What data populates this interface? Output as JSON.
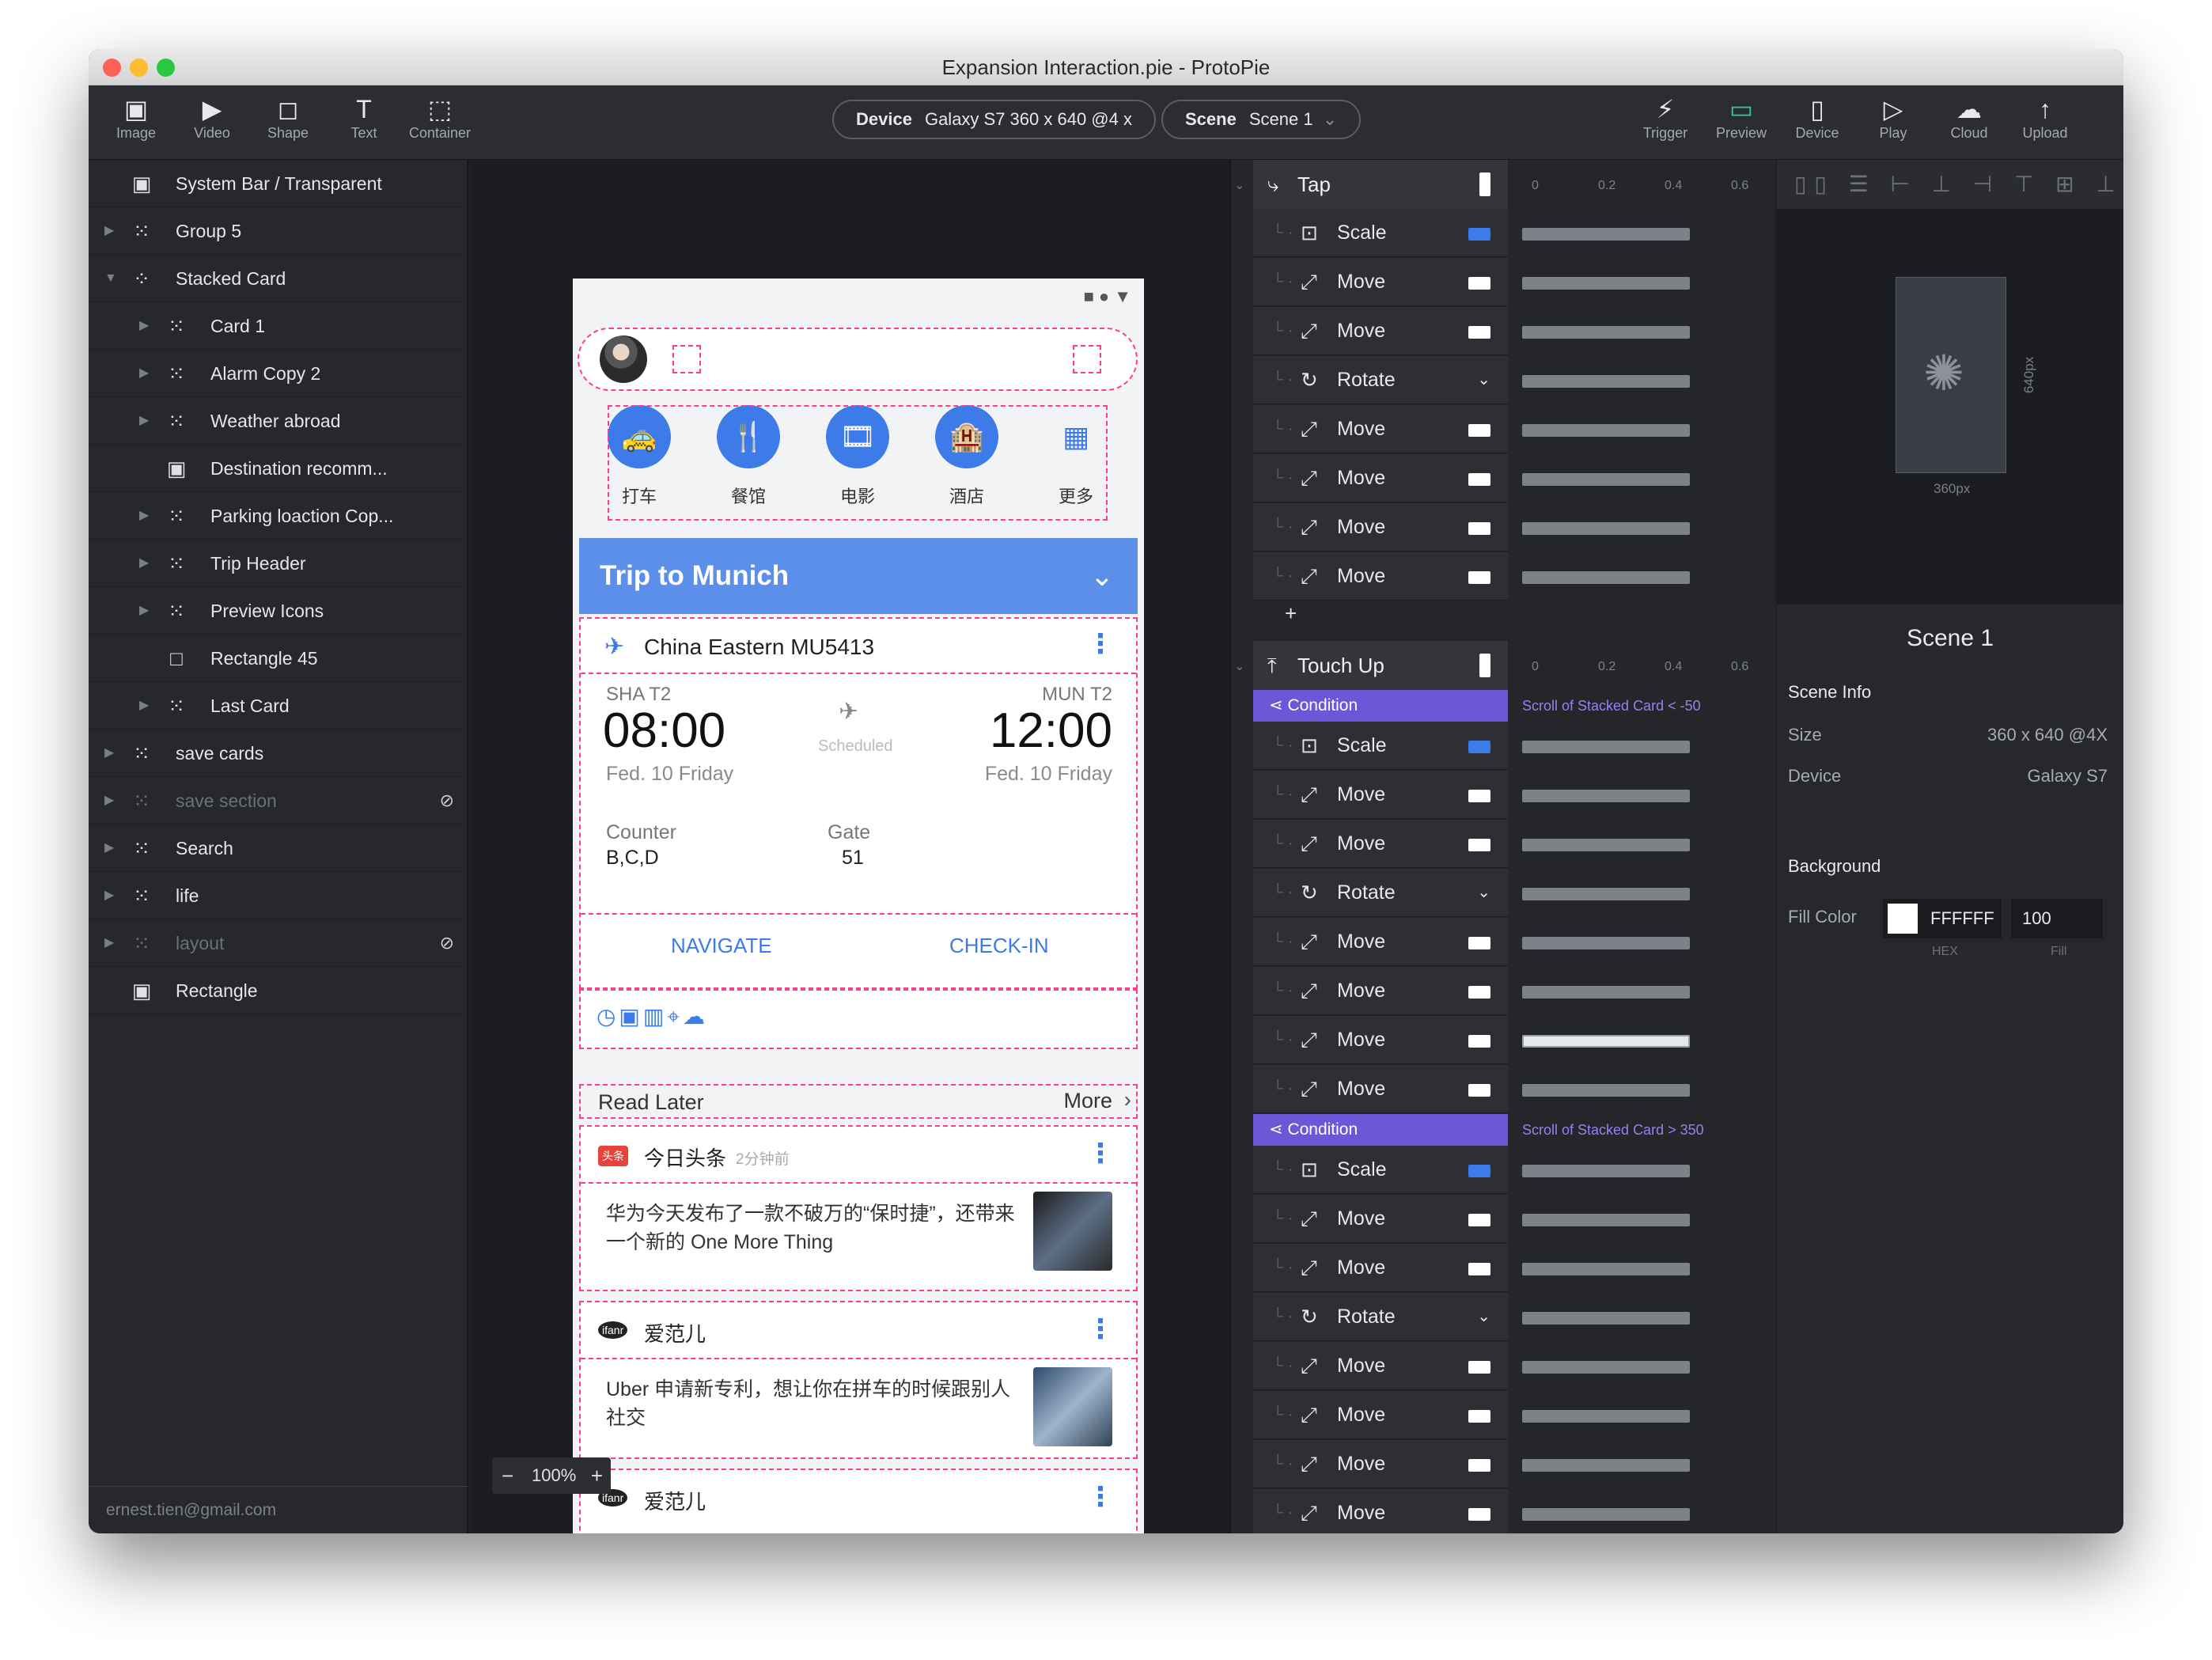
{
  "window": {
    "title": "Expansion Interaction.pie - ProtoPie"
  },
  "toolbar": {
    "left": [
      {
        "icon": "image-icon",
        "glyph": "▣",
        "label": "Image"
      },
      {
        "icon": "video-icon",
        "glyph": "▶",
        "label": "Video"
      },
      {
        "icon": "shape-icon",
        "glyph": "◻",
        "label": "Shape"
      },
      {
        "icon": "text-icon",
        "glyph": "T",
        "label": "Text"
      },
      {
        "icon": "container-icon",
        "glyph": "⬚",
        "label": "Container"
      }
    ],
    "device": {
      "key": "Device",
      "value": "Galaxy S7  360 x 640  @4 x"
    },
    "scene": {
      "key": "Scene",
      "value": "Scene 1",
      "caret": "⌄"
    },
    "right": [
      {
        "icon": "trigger-icon",
        "glyph": "⚡",
        "label": "Trigger"
      },
      {
        "icon": "preview-icon",
        "glyph": "▭",
        "label": "Preview"
      },
      {
        "icon": "device-icon",
        "glyph": "▯",
        "label": "Device"
      },
      {
        "icon": "play-icon",
        "glyph": "▷",
        "label": "Play"
      },
      {
        "icon": "cloud-icon",
        "glyph": "☁",
        "label": "Cloud"
      },
      {
        "icon": "upload-icon",
        "glyph": "↑",
        "label": "Upload"
      }
    ]
  },
  "layers": [
    {
      "name": "System Bar / Transparent",
      "indent": 0,
      "icon": "image",
      "caret": ""
    },
    {
      "name": "Group 5",
      "indent": 0,
      "icon": "group",
      "caret": "▶"
    },
    {
      "name": "Stacked Card",
      "indent": 0,
      "icon": "scroll",
      "caret": "▼"
    },
    {
      "name": "Card 1",
      "indent": 1,
      "icon": "group",
      "caret": "▶"
    },
    {
      "name": "Alarm Copy 2",
      "indent": 1,
      "icon": "group",
      "caret": "▶"
    },
    {
      "name": "Weather abroad",
      "indent": 1,
      "icon": "group",
      "caret": "▶"
    },
    {
      "name": "Destination recomm...",
      "indent": 1,
      "icon": "image",
      "caret": ""
    },
    {
      "name": "Parking loaction Cop...",
      "indent": 1,
      "icon": "group",
      "caret": "▶"
    },
    {
      "name": "Trip Header",
      "indent": 1,
      "icon": "group",
      "caret": "▶"
    },
    {
      "name": "Preview Icons",
      "indent": 1,
      "icon": "group",
      "caret": "▶"
    },
    {
      "name": "Rectangle 45",
      "indent": 1,
      "icon": "rect",
      "caret": ""
    },
    {
      "name": "Last Card",
      "indent": 1,
      "icon": "group",
      "caret": "▶"
    },
    {
      "name": "save cards",
      "indent": 0,
      "icon": "group",
      "caret": "▶"
    },
    {
      "name": "save section",
      "indent": 0,
      "icon": "group",
      "caret": "▶",
      "hidden": true
    },
    {
      "name": "Search",
      "indent": 0,
      "icon": "group",
      "caret": "▶"
    },
    {
      "name": "life",
      "indent": 0,
      "icon": "group",
      "caret": "▶"
    },
    {
      "name": "layout",
      "indent": 0,
      "icon": "group",
      "caret": "▶",
      "hidden": true
    },
    {
      "name": "Rectangle",
      "indent": 0,
      "icon": "image",
      "caret": ""
    }
  ],
  "account": {
    "email": "ernest.tien@gmail.com"
  },
  "zoom": {
    "minus": "−",
    "value": "100%",
    "plus": "+"
  },
  "phone": {
    "services": [
      {
        "label": "打车",
        "glyph": "🚕"
      },
      {
        "label": "餐馆",
        "glyph": "🍴"
      },
      {
        "label": "电影",
        "glyph": "🎞"
      },
      {
        "label": "酒店",
        "glyph": "🏨"
      },
      {
        "label": "更多",
        "glyph": "▦"
      }
    ],
    "trip": {
      "title": "Trip to Munich",
      "chevron": "⌄",
      "airline": "China Eastern MU5413",
      "from_code": "SHA T2",
      "from_time": "08:00",
      "from_date": "Fed. 10  Friday",
      "status": "Scheduled",
      "to_code": "MUN T2",
      "to_time": "12:00",
      "to_date": "Fed. 10  Friday",
      "counter_label": "Counter",
      "counter_value": "B,C,D",
      "gate_label": "Gate",
      "gate_value": "51",
      "navigate": "NAVIGATE",
      "checkin": "CHECK-IN"
    },
    "read_later": {
      "title": "Read Later",
      "more": "More"
    },
    "news": [
      {
        "source": "今日头条",
        "time": "2分钟前",
        "badge": "头条",
        "text": "华为今天发布了一款不破万的“保时捷”，还带来一个新的 One More Thing"
      },
      {
        "source": "爱范儿",
        "time": "",
        "badge": "ifanr",
        "text": "Uber 申请新专利，想让你在拼车的时候跟别人社交"
      },
      {
        "source": "爱范儿",
        "time": "",
        "badge": "ifanr",
        "text": ""
      }
    ]
  },
  "interactions": {
    "ruler": [
      "0",
      "0.2",
      "0.4",
      "0.6"
    ],
    "triggers": [
      {
        "name": "Tap",
        "responses": [
          "Scale",
          "Move",
          "Move",
          "Rotate",
          "Move",
          "Move",
          "Move",
          "Move"
        ]
      },
      {
        "name": "Touch Up",
        "conditions": [
          {
            "label": "Condition",
            "desc": "Scroll of Stacked Card < -50",
            "responses": [
              "Scale",
              "Move",
              "Move",
              "Rotate",
              "Move",
              "Move",
              "Move",
              "Move"
            ]
          },
          {
            "label": "Condition",
            "desc": "Scroll of Stacked Card > 350",
            "responses": [
              "Scale",
              "Move",
              "Move",
              "Rotate",
              "Move",
              "Move",
              "Move",
              "Move"
            ]
          }
        ]
      }
    ],
    "add": "+"
  },
  "scene_props": {
    "title": "Scene 1",
    "w_label": "360px",
    "h_label": "640px",
    "section_info": "Scene Info",
    "size_label": "Size",
    "size_value": "360 x 640 @4X",
    "device_label": "Device",
    "device_value": "Galaxy S7",
    "section_bg": "Background",
    "fill_label": "Fill Color",
    "hex": "FFFFFF",
    "opacity": "100",
    "hex_caption": "HEX",
    "fill_caption": "Fill"
  },
  "colors": {
    "accent": "#3d7be8",
    "condition": "#6d56d8",
    "guide": "#ff3d8a"
  }
}
